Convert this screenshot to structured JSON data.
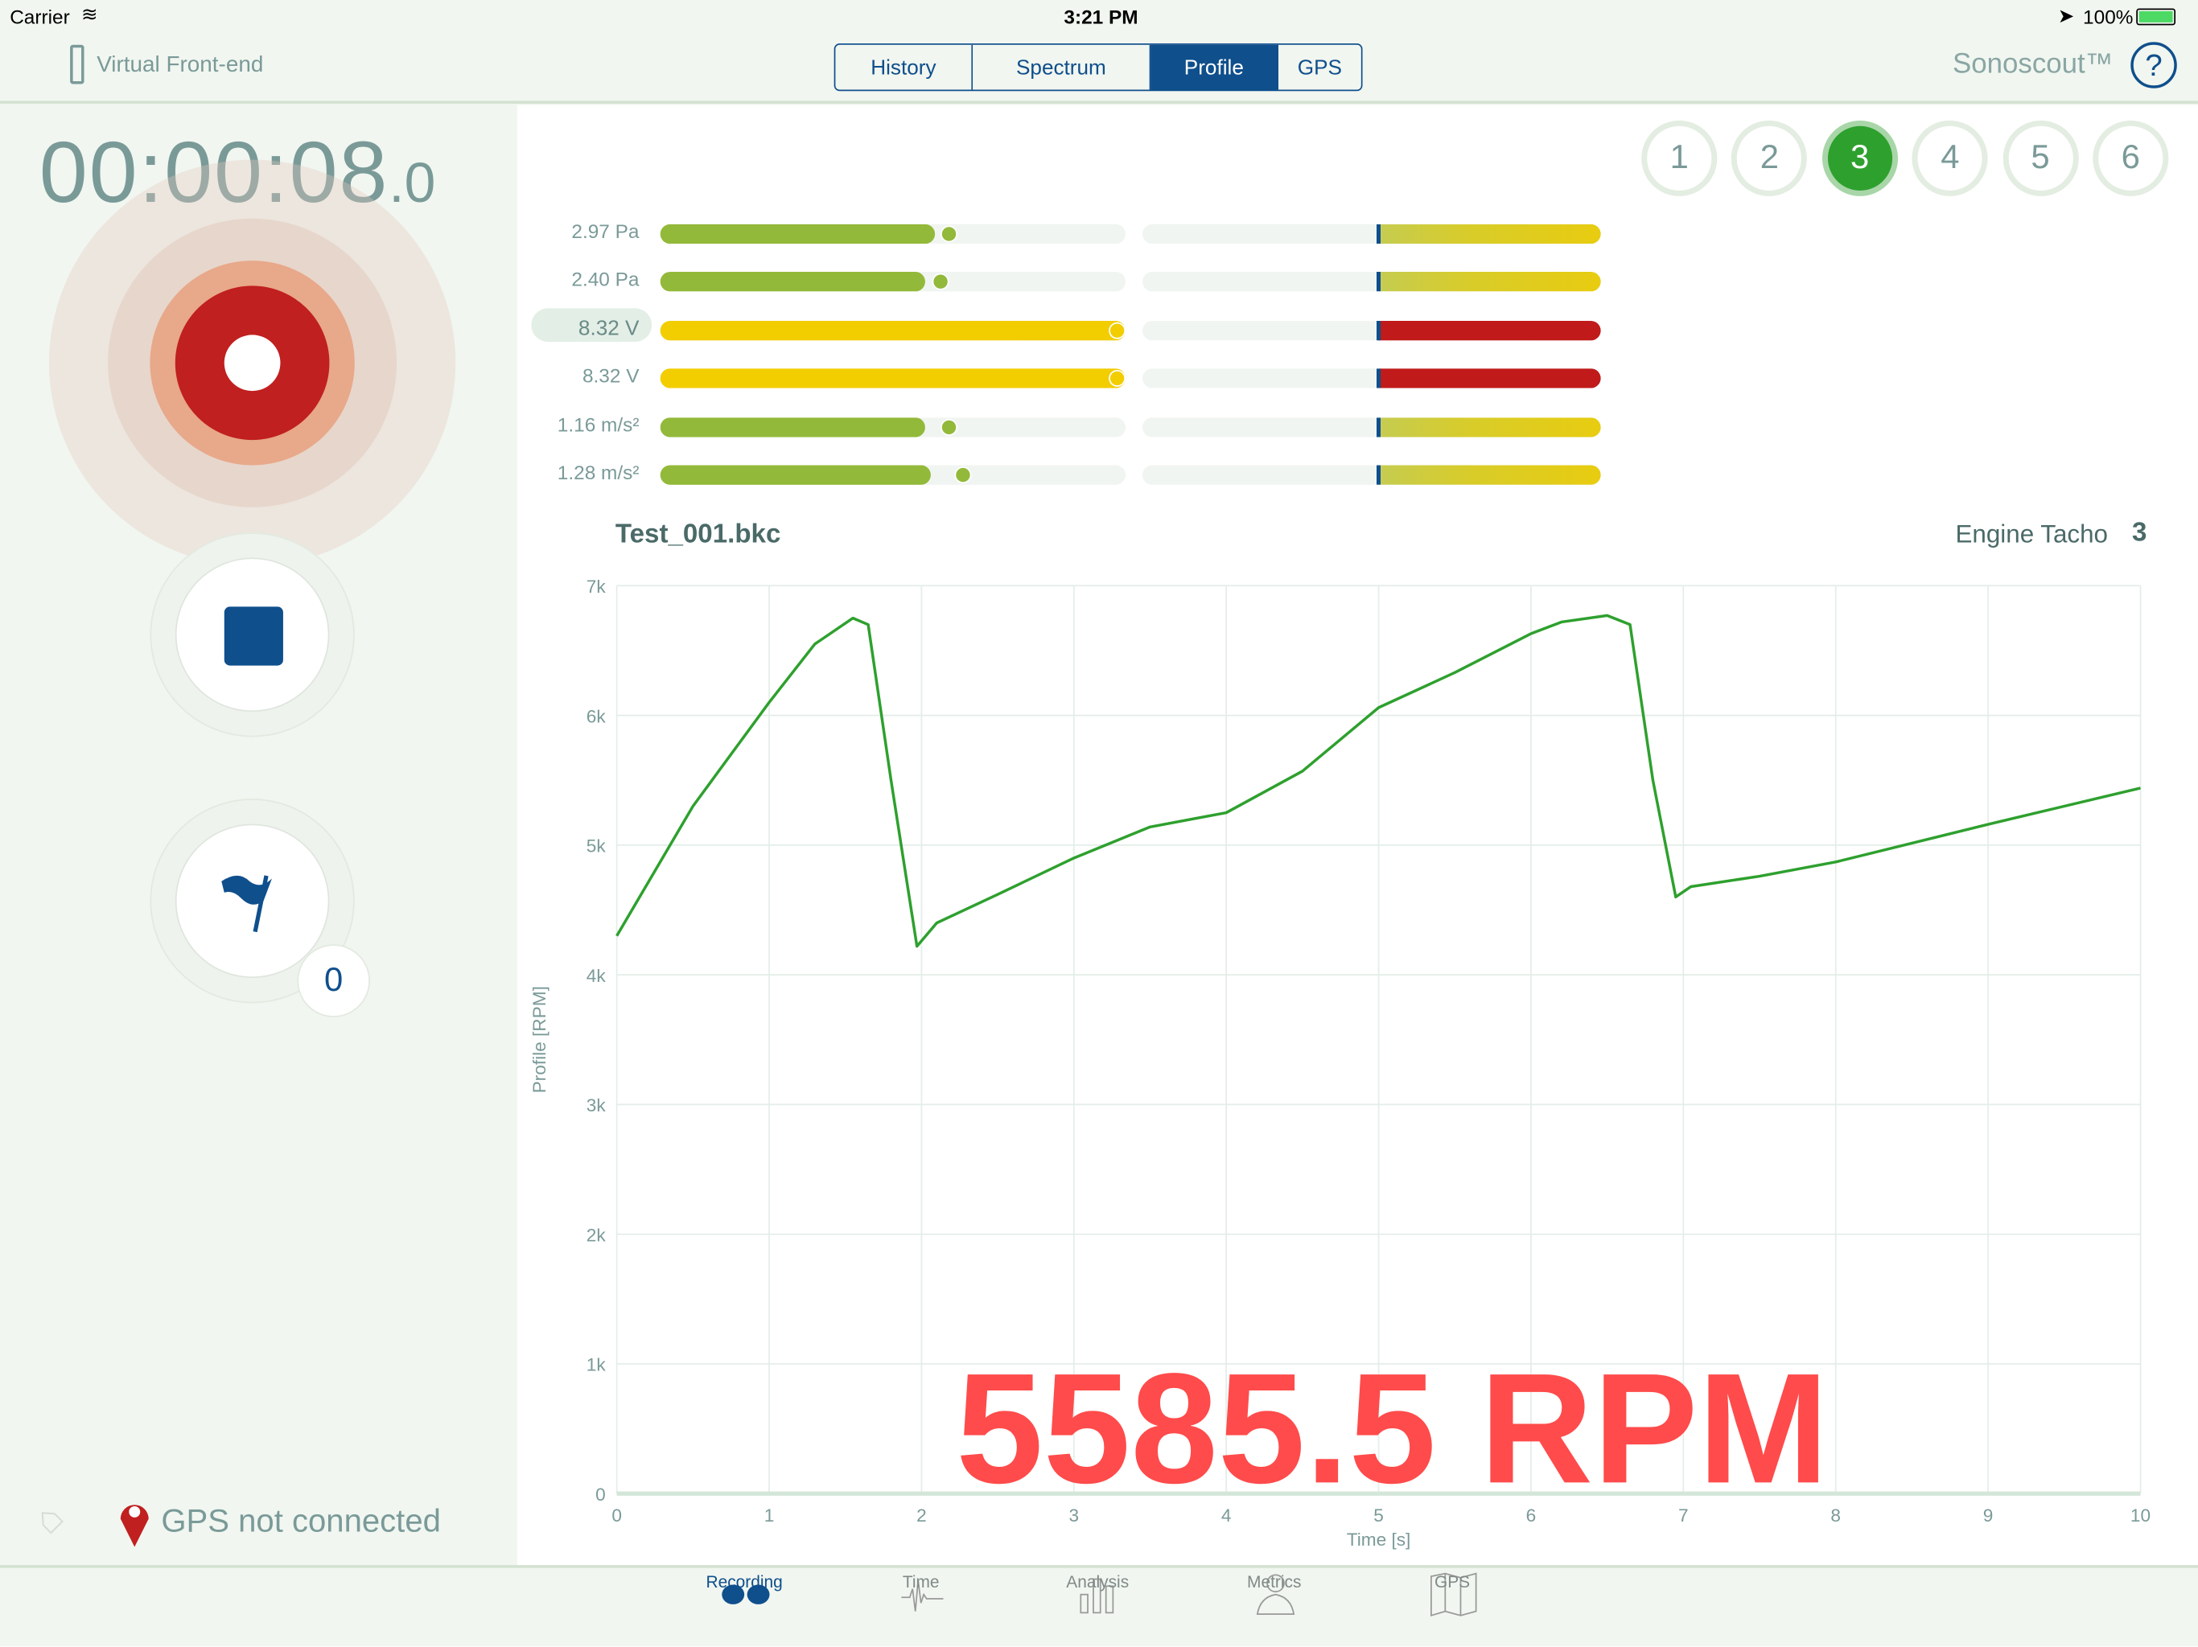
{
  "status_bar": {
    "carrier": "Carrier",
    "time": "3:21 PM",
    "battery": "100%",
    "battery_color": "#4cd964"
  },
  "header": {
    "device": "Virtual Front-end",
    "tabs": [
      {
        "label": "History",
        "active": false
      },
      {
        "label": "Spectrum",
        "active": false
      },
      {
        "label": "Profile",
        "active": true
      },
      {
        "label": "GPS",
        "active": false
      }
    ],
    "brand": "Sonoscout™",
    "help": "?"
  },
  "recorder": {
    "timer_main": "00:00:08",
    "timer_fraction": ".0",
    "marker_count": "0",
    "gps_status": "GPS not connected"
  },
  "channels": {
    "items": [
      "1",
      "2",
      "3",
      "4",
      "5",
      "6"
    ],
    "active": "3"
  },
  "levels": [
    {
      "label": "2.97 Pa",
      "level": 0.59,
      "peak": 0.64,
      "color": "#93b93a",
      "history_color": "yellow",
      "selected": false
    },
    {
      "label": "2.40 Pa",
      "level": 0.57,
      "peak": 0.62,
      "color": "#93b93a",
      "history_color": "yellow",
      "selected": false
    },
    {
      "label": "8.32 V",
      "level": 1.0,
      "peak": 1.0,
      "color": "#f2cd00",
      "history_color": "red",
      "selected": true
    },
    {
      "label": "8.32 V",
      "level": 1.0,
      "peak": 1.0,
      "color": "#f2cd00",
      "history_color": "red",
      "selected": false
    },
    {
      "label": "1.16 m/s²",
      "level": 0.57,
      "peak": 0.64,
      "color": "#93b93a",
      "history_color": "yellow",
      "selected": false
    },
    {
      "label": "1.28 m/s²",
      "level": 0.58,
      "peak": 0.67,
      "color": "#93b93a",
      "history_color": "yellow",
      "selected": false
    }
  ],
  "chart_title": {
    "file": "Test_001.bkc",
    "channel_name": "Engine Tacho",
    "channel_number": "3"
  },
  "readout": "5585.5 RPM",
  "chart_data": {
    "type": "line",
    "xlabel": "Time [s]",
    "ylabel": "Profile [RPM]",
    "xlim": [
      0,
      10
    ],
    "ylim": [
      0,
      7000
    ],
    "xticks": [
      "0",
      "1",
      "2",
      "3",
      "4",
      "5",
      "6",
      "7",
      "8",
      "9",
      "10"
    ],
    "yticks": [
      "0",
      "1k",
      "2k",
      "3k",
      "4k",
      "5k",
      "6k",
      "7k"
    ],
    "grid": true,
    "line_color": "#2ea02e",
    "series": [
      {
        "x": [
          0,
          0.5,
          1,
          1.3,
          1.55,
          1.65,
          1.8,
          1.97,
          2.1,
          2.5,
          3,
          3.5,
          4,
          4.5,
          5,
          5.5,
          6,
          6.2,
          6.5,
          6.65,
          6.8,
          6.95,
          7.05,
          7.5,
          8,
          9,
          10
        ],
        "y": [
          4300,
          5300,
          6100,
          6550,
          6750,
          6700,
          5500,
          4220,
          4400,
          4620,
          4900,
          5140,
          5250,
          5570,
          6060,
          6330,
          6630,
          6720,
          6770,
          6700,
          5500,
          4600,
          4680,
          4760,
          4870,
          5160,
          5440
        ]
      }
    ]
  },
  "tabbar": [
    {
      "label": "Recording",
      "active": true
    },
    {
      "label": "Time"
    },
    {
      "label": "Analysis"
    },
    {
      "label": "Metrics"
    },
    {
      "label": "GPS"
    }
  ]
}
